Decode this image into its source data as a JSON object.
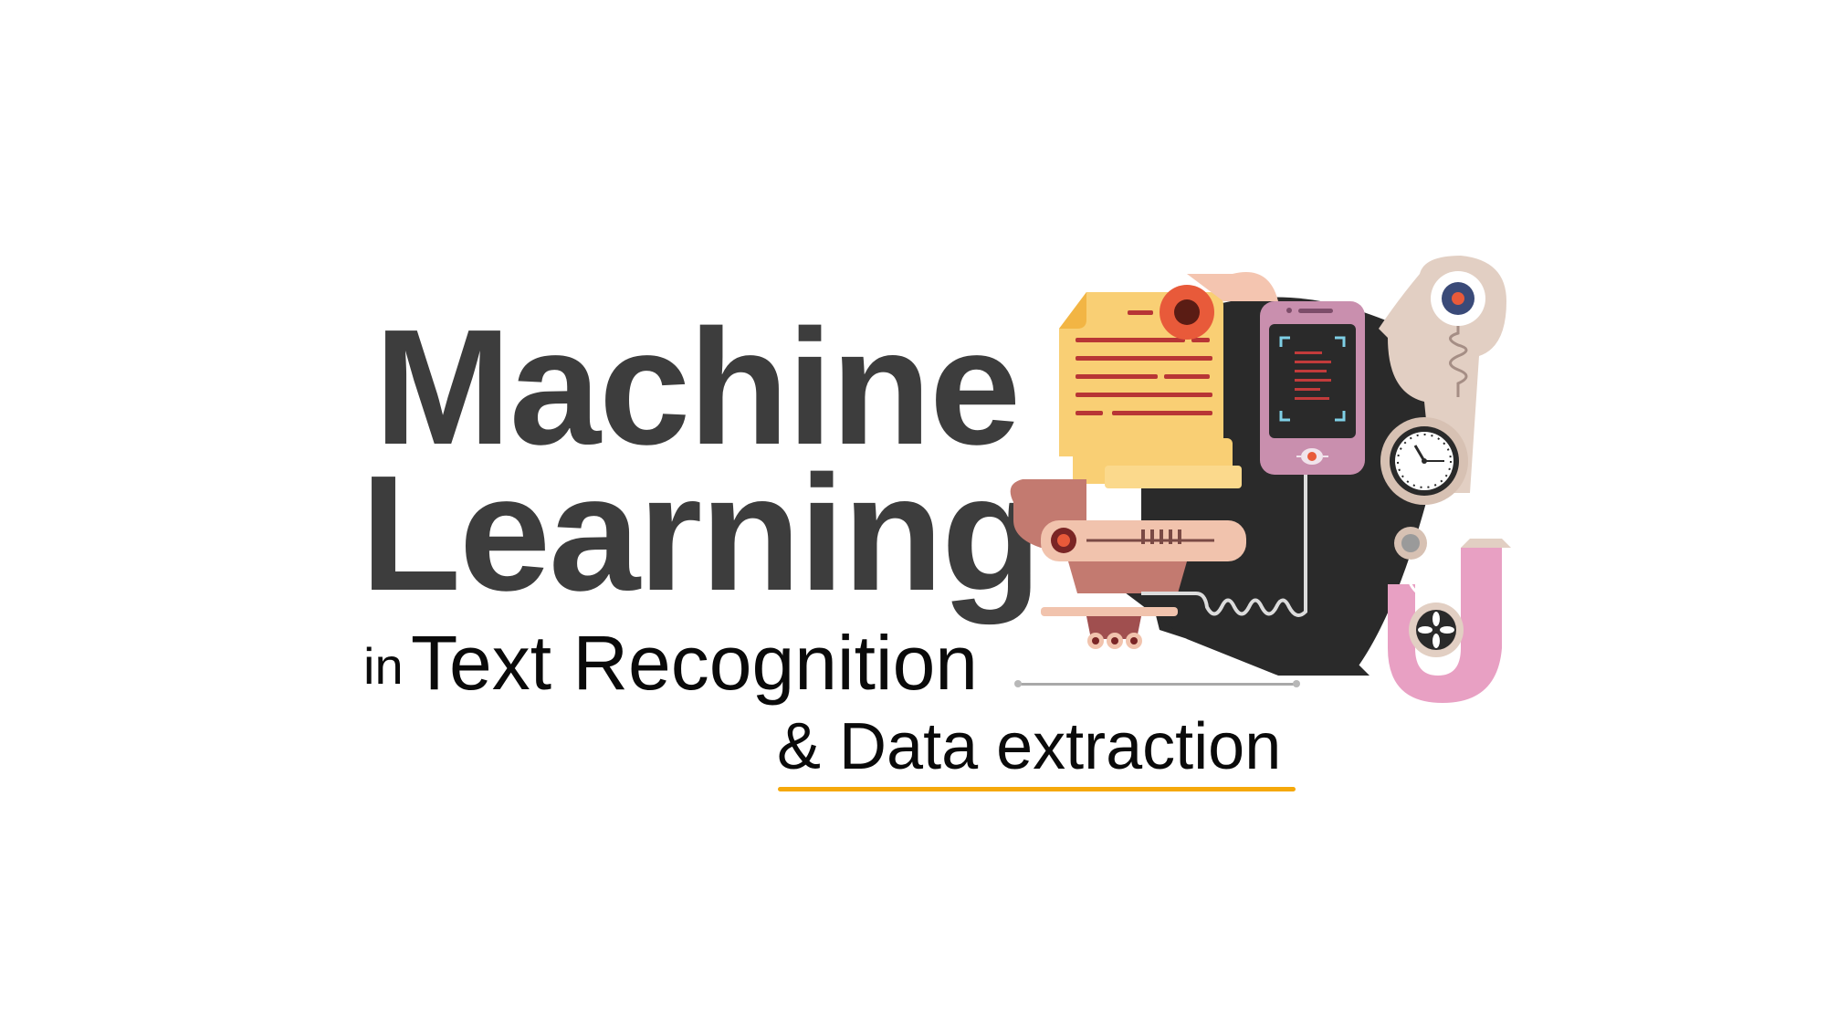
{
  "title": {
    "line1": "Machine",
    "line2": "Learning"
  },
  "subtitle": {
    "prefix": "in",
    "main": "Text Recognition",
    "secondary": "& Data extraction"
  },
  "colors": {
    "title": "#3d3d3d",
    "subtitle": "#0a0a0a",
    "accent_underline": "#f5a80a",
    "connector_line": "#a9a9a9",
    "dark_blob": "#2a2a2a",
    "document_yellow": "#f9cf74",
    "document_red_lines": "#b83535",
    "phone_pink": "#c98fae",
    "robot_head": "#e2cfc3",
    "pink_arm": "#e8a0c3",
    "red_button": "#e85a3a"
  },
  "illustration": {
    "icons": [
      "document-icon",
      "smartphone-scan-icon",
      "robot-head-icon",
      "clock-gauge-icon",
      "fan-icon",
      "printer-base-icon"
    ]
  }
}
